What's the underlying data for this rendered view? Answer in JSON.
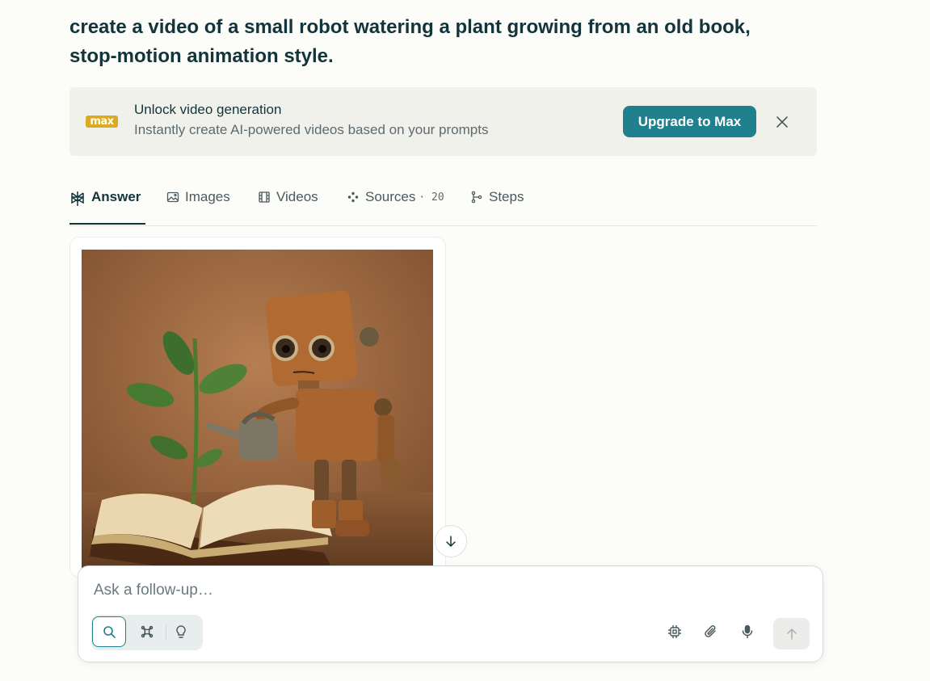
{
  "query": "create a video of a small robot watering a plant growing from an old book, stop-motion animation style.",
  "banner": {
    "badge": "max",
    "title": "Unlock video generation",
    "subtitle": "Instantly create AI-powered videos based on your prompts",
    "upgrade_label": "Upgrade to Max",
    "close_icon": "close-icon"
  },
  "tabs": [
    {
      "label": "Answer",
      "icon": "perplexity-logo-icon",
      "active": true
    },
    {
      "label": "Images",
      "icon": "image-icon"
    },
    {
      "label": "Videos",
      "icon": "film-icon"
    },
    {
      "label": "Sources",
      "icon": "sources-icon",
      "separator": "·",
      "count": "20"
    },
    {
      "label": "Steps",
      "icon": "steps-icon"
    }
  ],
  "composer": {
    "placeholder": "Ask a follow-up…",
    "modes": [
      "search-icon",
      "research-icon",
      "labs-lightbulb-icon"
    ],
    "tools": [
      "model-chip-icon",
      "attach-paperclip-icon",
      "microphone-icon"
    ],
    "send_icon": "arrow-up-icon"
  },
  "colors": {
    "accent": "#21808d",
    "background": "#fcfcf9",
    "banner_bg": "#f1f1ec",
    "max_badge": "#dcaa1e",
    "text": "#13343b"
  }
}
